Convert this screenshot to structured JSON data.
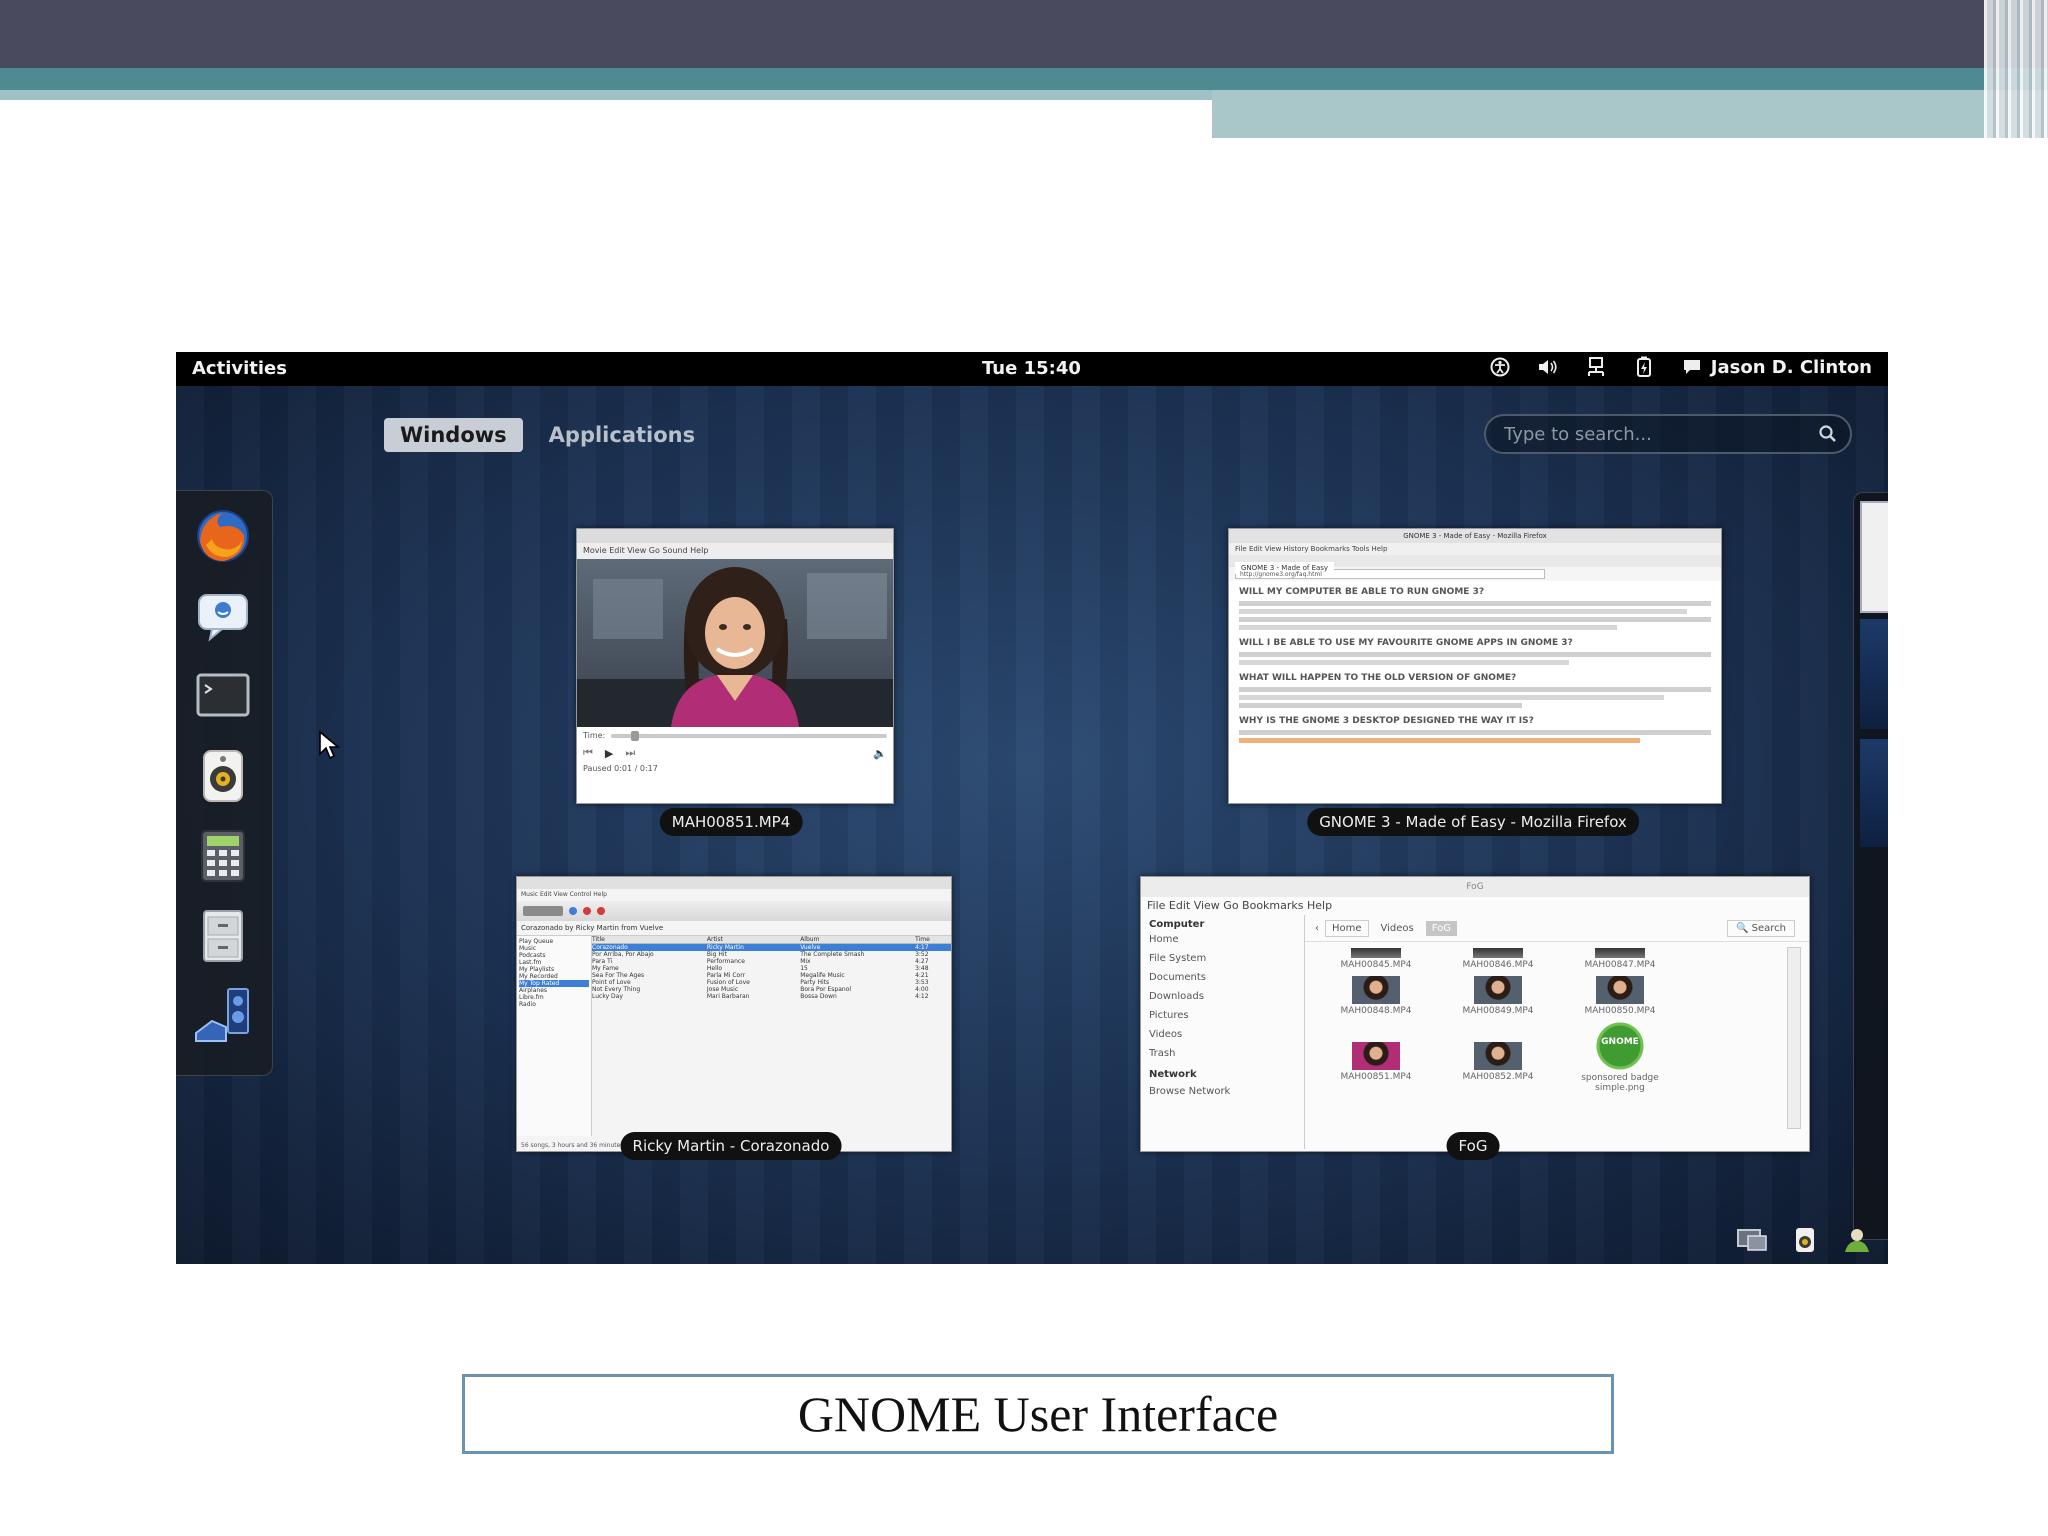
{
  "slide": {
    "caption": "GNOME User Interface"
  },
  "topbar": {
    "activities": "Activities",
    "clock": "Tue 15:40",
    "user": "Jason D. Clinton",
    "status_icons": [
      "accessibility-icon",
      "volume-icon",
      "network-icon",
      "battery-icon",
      "chat-icon"
    ]
  },
  "overview": {
    "tabs": [
      {
        "label": "Windows",
        "active": true
      },
      {
        "label": "Applications",
        "active": false
      }
    ],
    "search_placeholder": "Type to search..."
  },
  "dash": {
    "items": [
      {
        "name": "firefox-icon"
      },
      {
        "name": "empathy-chat-icon"
      },
      {
        "name": "terminal-icon"
      },
      {
        "name": "rhythmbox-speaker-icon"
      },
      {
        "name": "calculator-icon"
      },
      {
        "name": "file-cabinet-icon"
      },
      {
        "name": "system-monitor-icon"
      }
    ]
  },
  "windows": [
    {
      "caption": "MAH00851.MP4",
      "menu": "Movie  Edit  View  Go  Sound  Help",
      "time_label": "Time:",
      "status": "Paused  0:01 / 0:17"
    },
    {
      "caption": "GNOME 3 - Made of Easy - Mozilla Firefox",
      "title": "GNOME 3 - Made of Easy - Mozilla Firefox",
      "menu": "File  Edit  View  History  Bookmarks  Tools  Help",
      "tab": "GNOME 3 - Made of Easy",
      "url": "http://gnome3.org/faq.html",
      "headings": [
        "WILL MY COMPUTER BE ABLE TO RUN GNOME 3?",
        "WILL I BE ABLE TO USE MY FAVOURITE GNOME APPS IN GNOME 3?",
        "WHAT WILL HAPPEN TO THE OLD VERSION OF GNOME?",
        "WHY IS THE GNOME 3 DESKTOP DESIGNED THE WAY IT IS?"
      ]
    },
    {
      "caption": "Ricky Martin - Corazonado",
      "menu": "Music  Edit  View  Control  Help",
      "album_line": "Corazonado by Ricky Martin from Vuelve",
      "columns": [
        "Title",
        "Artist",
        "Album",
        "Time"
      ],
      "rows": [
        [
          "Corazonado",
          "Ricky Martin",
          "Vuelve",
          "4:17"
        ],
        [
          "Por Arriba, Por Abajo",
          "Big Hit",
          "The Complete Smash",
          "3:52"
        ],
        [
          "Para Ti",
          "Performance",
          "Mix",
          "4:27"
        ],
        [
          "My Fame",
          "Hello",
          "15",
          "3:48"
        ],
        [
          "Sea For The Ages",
          "Parla Mi Corr",
          "Megalife Music",
          "4:21"
        ],
        [
          "Point of Love",
          "Fusion of Love",
          "Party Hits",
          "3:53"
        ],
        [
          "Not Every Thing",
          "Jose Music",
          "Bora Por Espanol",
          "4:00"
        ],
        [
          "Lucky Day",
          "Mari Barbaran",
          "Bossa Down",
          "4:12"
        ]
      ],
      "sources": [
        "Play Queue",
        "Music",
        "Podcasts",
        "Last.fm",
        "My Playlists",
        "My Recorded",
        "My Top Rated",
        "Airplanes",
        "Libre.fm",
        "Radio"
      ],
      "footer": "56 songs, 3 hours and 36 minutes, 365.1 MB"
    },
    {
      "caption": "FoG",
      "title": "FoG",
      "menu": "File  Edit  View  Go  Bookmarks  Help",
      "sidebar_heading": "Computer",
      "sidebar_items": [
        "Home",
        "File System",
        "Documents",
        "Downloads",
        "Pictures",
        "Videos",
        "Trash"
      ],
      "network_heading": "Network",
      "network_items": [
        "Browse Network"
      ],
      "path": [
        "Home",
        "Videos",
        "FoG"
      ],
      "search_label": "Search",
      "files": [
        "MAH00845.MP4",
        "MAH00846.MP4",
        "MAH00847.MP4",
        "MAH00848.MP4",
        "MAH00849.MP4",
        "MAH00850.MP4",
        "MAH00851.MP4",
        "MAH00852.MP4",
        "sponsored badge simple.png"
      ],
      "badge_text": "GNOME"
    }
  ],
  "tray": {
    "icons": [
      "display-tray-icon",
      "speaker-tray-icon",
      "user-tray-icon"
    ]
  },
  "colors": {
    "slide_band_dark": "#4a4a5e",
    "slide_band_teal": "#4e8a91",
    "screen_background": "#1b3152",
    "selection_blue": "#3d7fd6",
    "caption_border": "#6b92b0"
  }
}
